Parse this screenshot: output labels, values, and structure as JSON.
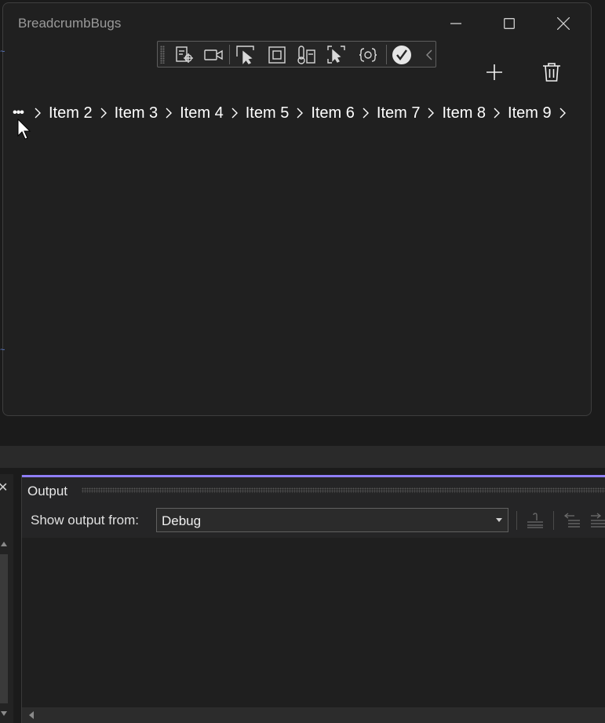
{
  "window": {
    "title": "BreadcrumbBugs"
  },
  "debug_toolbar": {
    "icons": [
      "live-visual-tree-icon",
      "record-icon",
      "select-element-icon",
      "display-layout-adorners-icon",
      "hot-reload-icon",
      "track-focus-icon",
      "binding-failures-icon",
      "accessibility-checker-icon",
      "collapse-chevron-icon"
    ]
  },
  "commands": {
    "add_icon": "plus-icon",
    "delete_icon": "trash-icon"
  },
  "breadcrumb": {
    "overflow": "•••",
    "items": [
      "Item 2",
      "Item 3",
      "Item 4",
      "Item 5",
      "Item 6",
      "Item 7",
      "Item 8",
      "Item 9"
    ]
  },
  "output": {
    "title": "Output",
    "show_label": "Show output from:",
    "source_value": "Debug"
  },
  "colors": {
    "accent": "#8f7ef5",
    "window_bg": "#202020",
    "panel_bg": "#252526"
  }
}
